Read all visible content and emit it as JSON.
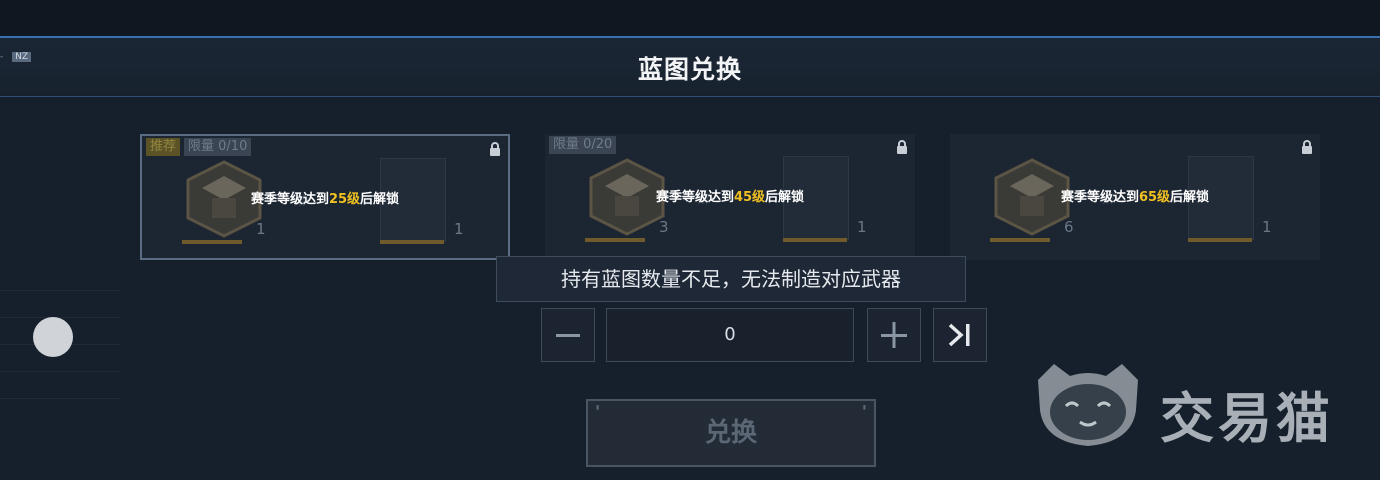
{
  "header": {
    "title": "蓝图兑换",
    "hud_fragment": "- NZ",
    "hud_tag": "NZ"
  },
  "cards": [
    {
      "badges": [
        "推荐",
        "限量 0/10"
      ],
      "unlock_prefix": "赛季等级达到",
      "unlock_level": "25级",
      "unlock_suffix": "后解锁",
      "box_count": "1",
      "weapon_count": "1",
      "locked": true,
      "selected": true
    },
    {
      "badges": [
        "限量 0/20"
      ],
      "unlock_prefix": "赛季等级达到",
      "unlock_level": "45级",
      "unlock_suffix": "后解锁",
      "box_count": "3",
      "weapon_count": "1",
      "locked": true,
      "selected": false
    },
    {
      "badges": [],
      "unlock_prefix": "赛季等级达到",
      "unlock_level": "65级",
      "unlock_suffix": "后解锁",
      "box_count": "6",
      "weapon_count": "1",
      "locked": true,
      "selected": false
    }
  ],
  "tooltip": {
    "text": "持有蓝图数量不足，无法制造对应武器"
  },
  "quantity": {
    "value": "0",
    "minus_icon": "minus-icon",
    "plus_icon": "plus-icon",
    "max_icon": "skip-to-end-icon"
  },
  "exchange": {
    "label": "兑换"
  },
  "watermark": {
    "text": "交易猫",
    "icon": "cat-face-icon"
  },
  "colors": {
    "accent_blue": "#3c6fb0",
    "level_gold": "#f0c020",
    "background": "#16202c"
  }
}
